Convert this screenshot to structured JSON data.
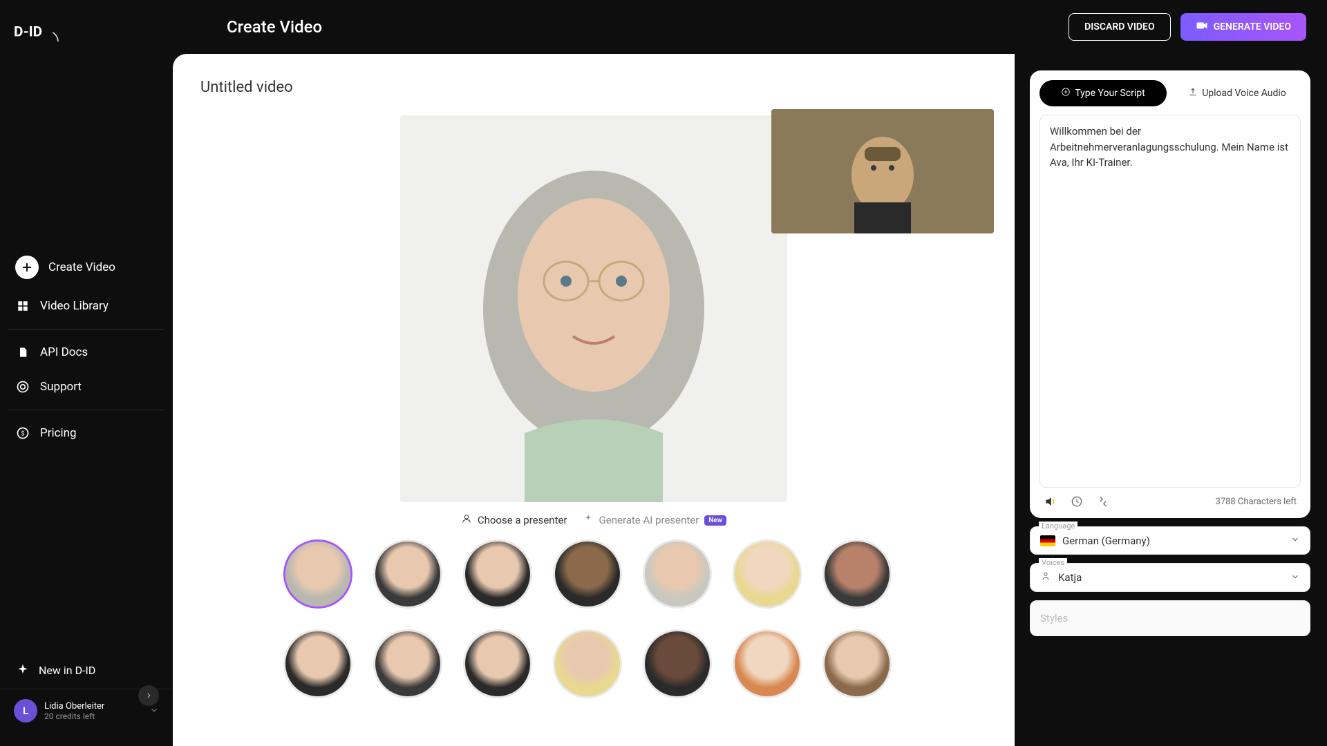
{
  "header": {
    "page_title": "Create Video",
    "discard_label": "DISCARD VIDEO",
    "generate_label": "GENERATE VIDEO"
  },
  "sidebar": {
    "create_video": "Create Video",
    "video_library": "Video Library",
    "api_docs": "API Docs",
    "support": "Support",
    "pricing": "Pricing",
    "new_in": "New in D-ID"
  },
  "profile": {
    "initial": "L",
    "name": "Lidia Oberleiter",
    "credits": "20 credits left"
  },
  "editor": {
    "video_title": "Untitled video",
    "choose_presenter": "Choose a presenter",
    "generate_ai_presenter": "Generate AI presenter",
    "new_badge": "New"
  },
  "script": {
    "tab_type": "Type Your Script",
    "tab_upload": "Upload Voice Audio",
    "text": "Willkommen bei der Arbeitnehmerveranlagungsschulung. Mein Name ist Ava, Ihr KI-Trainer.",
    "char_count": "3788 Characters left",
    "language_label": "Language",
    "language_value": "German (Germany)",
    "voices_label": "Voices",
    "voices_value": "Katja",
    "styles_label": "Styles"
  }
}
